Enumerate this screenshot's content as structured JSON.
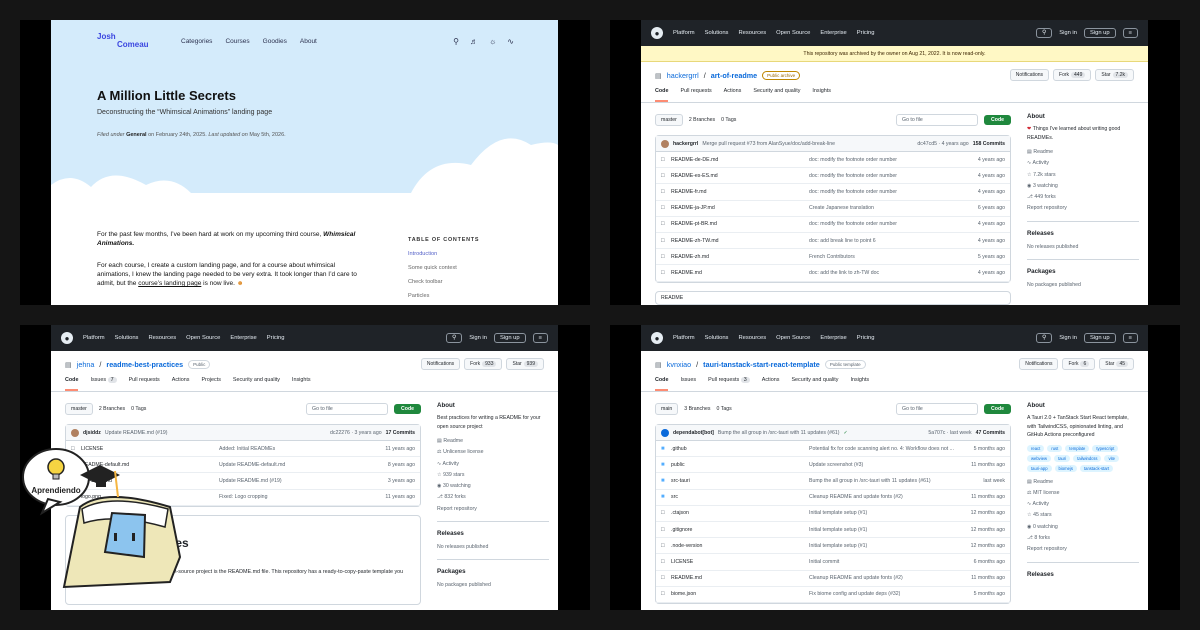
{
  "blog": {
    "logo": [
      "Josh",
      "Comeau"
    ],
    "nav": [
      "Categories",
      "Courses",
      "Goodies",
      "About"
    ],
    "title": "A Million Little Secrets",
    "subtitle": "Deconstructing the “Whimsical Animations” landing page",
    "meta": {
      "filed": "Filed under",
      "category": "General",
      "on": "on February 24th, 2025.",
      "updated_label": "Last updated on",
      "updated": "May 5th, 2026."
    },
    "p1": "For the past few months, I’ve been hard at work on my upcoming third course,",
    "p1_em": "Whimsical Animations.",
    "p2": "For each course, I create a custom landing page, and for a course about whimsical animations, I knew the landing page needed to be very extra. It took longer than I’d care to admit, but the",
    "p2_link": "course’s landing page",
    "p2_end": "is now live.",
    "toc_heading": "TABLE OF CONTENTS",
    "toc": [
      "Introduction",
      "Some quick context",
      "Check toolbar",
      "Particles"
    ]
  },
  "nav": {
    "items": [
      "Platform",
      "Solutions",
      "Resources",
      "Open Source",
      "Enterprise",
      "Pricing"
    ],
    "sign_in": "Sign in",
    "sign_up": "Sign up"
  },
  "repo1": {
    "archive_banner": "This repository was archived by the owner on Aug 21, 2022. It is now read-only.",
    "owner": "hackergrrl",
    "name": "art-of-readme",
    "badge": "Public archive",
    "actions": [
      {
        "label": "Notifications",
        "count": ""
      },
      {
        "label": "Fork",
        "count": "449"
      },
      {
        "label": "Star",
        "count": "7.2k"
      }
    ],
    "tabs": [
      {
        "label": "Code",
        "count": ""
      },
      {
        "label": "Pull requests",
        "count": ""
      },
      {
        "label": "Actions",
        "count": ""
      },
      {
        "label": "Security and quality",
        "count": ""
      },
      {
        "label": "Insights",
        "count": ""
      }
    ],
    "branch": "master",
    "branches": "2 Branches",
    "tags": "0 Tags",
    "search": "Go to file",
    "code": "Code",
    "commit": {
      "author": "hackergrrl",
      "msg": "Merge pull request #73 from AlanSyue/doc/add-break-line",
      "right": "dc47cd5 · 4 years ago",
      "count": "158 Commits"
    },
    "files": [
      {
        "name": "README-de-DE.md",
        "msg": "doc: modify the footnote order number",
        "time": "4 years ago"
      },
      {
        "name": "README-es-ES.md",
        "msg": "doc: modify the footnote order number",
        "time": "4 years ago"
      },
      {
        "name": "README-fr.md",
        "msg": "doc: modify the footnote order number",
        "time": "4 years ago"
      },
      {
        "name": "README-ja-JP.md",
        "msg": "Create Japanese translation",
        "time": "6 years ago"
      },
      {
        "name": "README-pt-BR.md",
        "msg": "doc: modify the footnote order number",
        "time": "4 years ago"
      },
      {
        "name": "README-zh-TW.md",
        "msg": "doc: add break line to point 6",
        "time": "4 years ago"
      },
      {
        "name": "README-zh.md",
        "msg": "French Contributors",
        "time": "5 years ago"
      },
      {
        "name": "README.md",
        "msg": "doc: add the link to zh-TW doc",
        "time": "4 years ago"
      }
    ],
    "readme_tab": "README",
    "about": "About",
    "desc": "Things I've learned about writing good READMEs.",
    "links": [
      "Readme",
      "Activity",
      "7.2k stars",
      "3 watching",
      "449 forks",
      "Report repository"
    ],
    "releases": "Releases",
    "no_releases": "No releases published",
    "packages": "Packages",
    "no_packages": "No packages published"
  },
  "repo2": {
    "owner": "jehna",
    "name": "readme-best-practices",
    "badge": "Public",
    "actions": [
      {
        "label": "Notifications",
        "count": ""
      },
      {
        "label": "Fork",
        "count": "933"
      },
      {
        "label": "Star",
        "count": "939"
      }
    ],
    "tabs": [
      {
        "label": "Code",
        "count": ""
      },
      {
        "label": "Issues",
        "count": "7"
      },
      {
        "label": "Pull requests",
        "count": ""
      },
      {
        "label": "Actions",
        "count": ""
      },
      {
        "label": "Projects",
        "count": ""
      },
      {
        "label": "Security and quality",
        "count": ""
      },
      {
        "label": "Insights",
        "count": ""
      }
    ],
    "branch": "master",
    "branches": "2 Branches",
    "tags": "0 Tags",
    "search": "Go to file",
    "code": "Code",
    "commit": {
      "author": "djsiddz",
      "msg": "Update README.md (#19)",
      "right": "dc22276 · 3 years ago",
      "count": "17 Commits"
    },
    "files": [
      {
        "name": "LICENSE",
        "msg": "Added: Initial READMEs",
        "time": "11 years ago"
      },
      {
        "name": "README-default.md",
        "msg": "Update README-default.md",
        "time": "8 years ago"
      },
      {
        "name": "README.md",
        "msg": "Update README.md (#19)",
        "time": "3 years ago"
      },
      {
        "name": "logo.png",
        "msg": "Fixed: Logo cropping",
        "time": "11 years ago"
      }
    ],
    "readme_heading": "practices",
    "readme_quote": "A p... your README.md from",
    "readme_p": "One of the most crucial things in your open-source project is the README.md file. This repository has a ready-to-copy-paste template you can use for all your projects.",
    "about": "About",
    "desc": "Best practices for writing a README for your open source project",
    "links": [
      "Readme",
      "Unlicense license",
      "Activity",
      "939 stars",
      "30 watching",
      "832 forks",
      "Report repository"
    ],
    "releases": "Releases",
    "no_releases": "No releases published",
    "packages": "Packages",
    "no_packages": "No packages published"
  },
  "repo3": {
    "owner": "kvnxiao",
    "name": "tauri-tanstack-start-react-template",
    "badge": "Public template",
    "actions": [
      {
        "label": "Notifications",
        "count": ""
      },
      {
        "label": "Fork",
        "count": "6"
      },
      {
        "label": "Star",
        "count": "45"
      }
    ],
    "tabs": [
      {
        "label": "Code",
        "count": ""
      },
      {
        "label": "Issues",
        "count": ""
      },
      {
        "label": "Pull requests",
        "count": "3"
      },
      {
        "label": "Actions",
        "count": ""
      },
      {
        "label": "Security and quality",
        "count": ""
      },
      {
        "label": "Insights",
        "count": ""
      }
    ],
    "branch": "main",
    "branches": "3 Branches",
    "tags": "0 Tags",
    "search": "Go to file",
    "code": "Code",
    "commit": {
      "author": "dependabot[bot]",
      "msg": "Bump the all group in /src-tauri with 11 updates (#61)",
      "right": "5a707c · last week",
      "count": "47 Commits"
    },
    "files": [
      {
        "name": ".github",
        "msg": "Potential fix for code scanning alert no. 4: Workflow does not ...",
        "time": "5 months ago",
        "dir": true
      },
      {
        "name": "public",
        "msg": "Update screenshot (#3)",
        "time": "11 months ago",
        "dir": true
      },
      {
        "name": "src-tauri",
        "msg": "Bump the all group in /src-tauri with 11 updates (#61)",
        "time": "last week",
        "dir": true
      },
      {
        "name": "src",
        "msg": "Cleanup README and update fonts (#2)",
        "time": "11 months ago",
        "dir": true
      },
      {
        "name": ".ctajson",
        "msg": "Initial template setup (#1)",
        "time": "12 months ago"
      },
      {
        "name": ".gitignore",
        "msg": "Initial template setup (#1)",
        "time": "12 months ago"
      },
      {
        "name": ".node-version",
        "msg": "Initial template setup (#1)",
        "time": "12 months ago"
      },
      {
        "name": "LICENSE",
        "msg": "Initial commit",
        "time": "6 months ago"
      },
      {
        "name": "README.md",
        "msg": "Cleanup README and update fonts (#2)",
        "time": "11 months ago"
      },
      {
        "name": "biome.json",
        "msg": "Fix biome config and update deps (#32)",
        "time": "5 months ago"
      }
    ],
    "about": "About",
    "desc": "A Tauri 2.0 + TanStack Start React template, with TailwindCSS, opinionated linting, and GitHub Actions preconfigured",
    "topics": [
      "react",
      "rust",
      "template",
      "typescript",
      "webview",
      "tauri",
      "tailwindcss",
      "vite",
      "tauri-app",
      "biomejs",
      "tanstack-start"
    ],
    "links": [
      "Readme",
      "MIT license",
      "Activity",
      "45 stars",
      "0 watching",
      "8 forks",
      "Report repository"
    ],
    "releases": "Releases"
  },
  "mascot": {
    "text": "Aprendiendo"
  }
}
